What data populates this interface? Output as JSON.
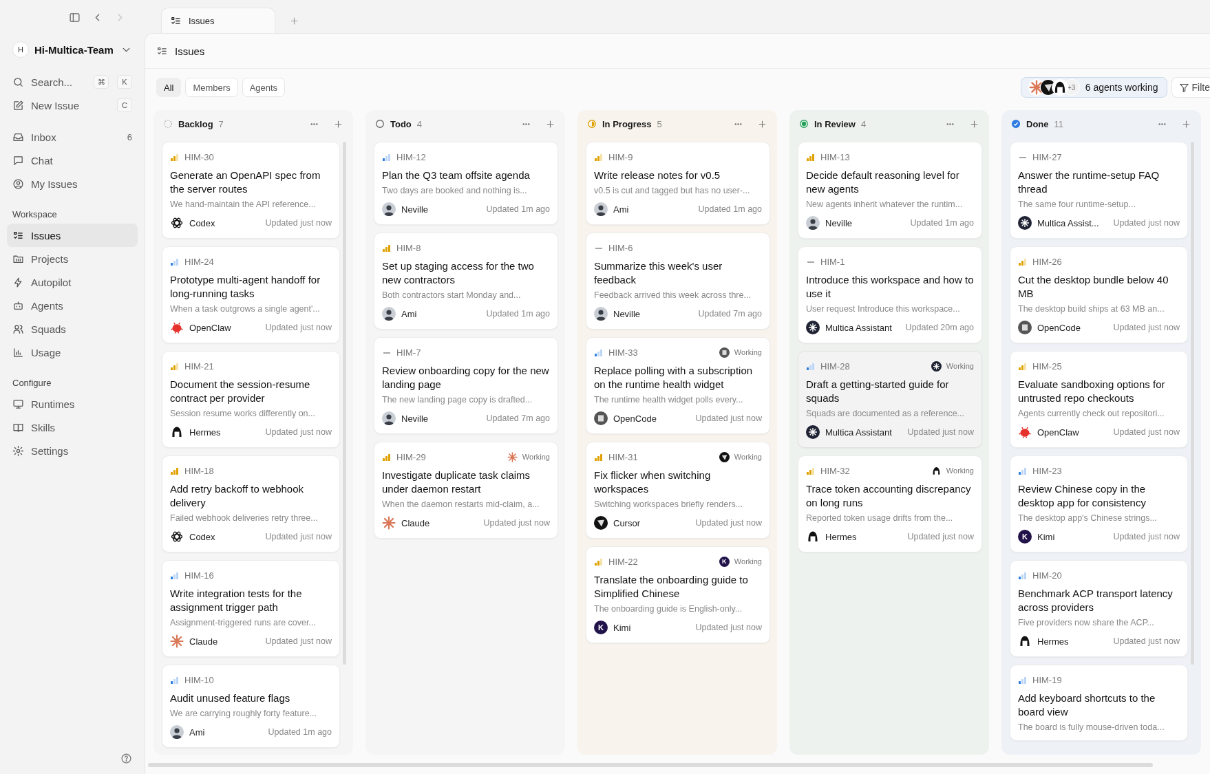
{
  "top_nav": {
    "forward_disabled": true
  },
  "sidebar": {
    "team": {
      "initial": "H",
      "name": "Hi-Multica-Team"
    },
    "actions": [
      {
        "label": "Search...",
        "keys": [
          "⌘",
          "K"
        ]
      },
      {
        "label": "New Issue",
        "keys": [
          "C"
        ]
      }
    ],
    "nav": [
      {
        "label": "Inbox",
        "badge": "6",
        "selected": false
      },
      {
        "label": "Chat",
        "selected": false
      },
      {
        "label": "My Issues",
        "selected": false
      }
    ],
    "sections": [
      {
        "title": "Workspace",
        "items": [
          {
            "label": "Issues",
            "selected": true
          },
          {
            "label": "Projects",
            "selected": false
          },
          {
            "label": "Autopilot",
            "selected": false
          },
          {
            "label": "Agents",
            "selected": false
          },
          {
            "label": "Squads",
            "selected": false
          },
          {
            "label": "Usage",
            "selected": false
          }
        ]
      },
      {
        "title": "Configure",
        "items": [
          {
            "label": "Runtimes",
            "selected": false
          },
          {
            "label": "Skills",
            "selected": false
          },
          {
            "label": "Settings",
            "selected": false
          }
        ]
      }
    ]
  },
  "tabs": [
    {
      "label": "Issues",
      "selected": true
    }
  ],
  "header": {
    "title": "Issues"
  },
  "filters": [
    {
      "label": "All",
      "selected": true
    },
    {
      "label": "Members",
      "selected": false
    },
    {
      "label": "Agents",
      "selected": false
    }
  ],
  "agents_working": {
    "avatars": [
      {
        "kind": "claude"
      },
      {
        "kind": "cursor"
      },
      {
        "kind": "hermes"
      }
    ],
    "more": "+3",
    "label": "6 agents working"
  },
  "filter_button": {
    "label": "Filte"
  },
  "columns": [
    {
      "title": "Backlog",
      "count": "7",
      "kind": "backlog",
      "scroll": true,
      "cards": [
        {
          "id": "HIM-30",
          "priority": {
            "kind": "medium"
          },
          "title": "Generate an OpenAPI spec from the server routes",
          "desc": "We hand-maintain the API reference...",
          "assignee": {
            "name": "Codex",
            "kind": "codex"
          },
          "updated": "Updated just now",
          "selected": false
        },
        {
          "id": "HIM-24",
          "priority": {
            "kind": "low"
          },
          "title": "Prototype multi-agent handoff for long-running tasks",
          "desc": "When a task outgrows a single agent'...",
          "assignee": {
            "name": "OpenClaw",
            "kind": "openclaw"
          },
          "updated": "Updated just now",
          "selected": false
        },
        {
          "id": "HIM-21",
          "priority": {
            "kind": "medium"
          },
          "title": "Document the session-resume contract per provider",
          "desc": "Session resume works differently on...",
          "assignee": {
            "name": "Hermes",
            "kind": "hermes"
          },
          "updated": "Updated just now",
          "selected": false
        },
        {
          "id": "HIM-18",
          "priority": {
            "kind": "high"
          },
          "title": "Add retry backoff to webhook delivery",
          "desc": "Failed webhook deliveries retry three...",
          "assignee": {
            "name": "Codex",
            "kind": "codex"
          },
          "updated": "Updated just now",
          "selected": false
        },
        {
          "id": "HIM-16",
          "priority": {
            "kind": "low"
          },
          "title": "Write integration tests for the assignment trigger path",
          "desc": "Assignment-triggered runs are cover...",
          "assignee": {
            "name": "Claude",
            "kind": "claude"
          },
          "updated": "Updated just now",
          "selected": false
        },
        {
          "id": "HIM-10",
          "priority": {
            "kind": "low"
          },
          "title": "Audit unused feature flags",
          "desc": "We are carrying roughly forty feature...",
          "assignee": {
            "name": "Ami",
            "kind": "person"
          },
          "updated": "Updated 1m ago",
          "selected": false
        }
      ]
    },
    {
      "title": "Todo",
      "count": "4",
      "kind": "todo",
      "scroll": false,
      "cards": [
        {
          "id": "HIM-12",
          "priority": {
            "kind": "low"
          },
          "title": "Plan the Q3 team offsite agenda",
          "desc": "Two days are booked and nothing is...",
          "assignee": {
            "name": "Neville",
            "kind": "person"
          },
          "updated": "Updated 1m ago",
          "selected": false
        },
        {
          "id": "HIM-8",
          "priority": {
            "kind": "high"
          },
          "title": "Set up staging access for the two new contractors",
          "desc": "Both contractors start Monday and...",
          "assignee": {
            "name": "Ami",
            "kind": "person"
          },
          "updated": "Updated 1m ago",
          "selected": false
        },
        {
          "id": "HIM-7",
          "priority": {
            "kind": "none"
          },
          "title": "Review onboarding copy for the new landing page",
          "desc": "The new landing page copy is drafted...",
          "assignee": {
            "name": "Neville",
            "kind": "person"
          },
          "updated": "Updated 7m ago",
          "selected": false
        },
        {
          "id": "HIM-29",
          "priority": {
            "kind": "high"
          },
          "title": "Investigate duplicate task claims under daemon restart",
          "desc": "When the daemon restarts mid-claim, a...",
          "assignee": {
            "name": "Claude",
            "kind": "claude"
          },
          "updated": "Updated just now",
          "working": {
            "kind": "claude",
            "label": "Working"
          },
          "selected": false
        }
      ]
    },
    {
      "title": "In Progress",
      "count": "5",
      "kind": "in_progress",
      "scroll": false,
      "cards": [
        {
          "id": "HIM-9",
          "priority": {
            "kind": "medium"
          },
          "title": "Write release notes for v0.5",
          "desc": "v0.5 is cut and tagged but has no user-...",
          "assignee": {
            "name": "Ami",
            "kind": "person"
          },
          "updated": "Updated 1m ago",
          "selected": false
        },
        {
          "id": "HIM-6",
          "priority": {
            "kind": "none"
          },
          "title": "Summarize this week's user feedback",
          "desc": "Feedback arrived this week across thre...",
          "assignee": {
            "name": "Neville",
            "kind": "person"
          },
          "updated": "Updated 7m ago",
          "selected": false
        },
        {
          "id": "HIM-33",
          "priority": {
            "kind": "low"
          },
          "title": "Replace polling with a subscription on the runtime health widget",
          "desc": "The runtime health widget polls every...",
          "assignee": {
            "name": "OpenCode",
            "kind": "opencode"
          },
          "updated": "Updated just now",
          "working": {
            "kind": "opencode",
            "label": "Working"
          },
          "selected": false
        },
        {
          "id": "HIM-31",
          "priority": {
            "kind": "high"
          },
          "title": "Fix flicker when switching workspaces",
          "desc": "Switching workspaces briefly renders...",
          "assignee": {
            "name": "Cursor",
            "kind": "cursor"
          },
          "updated": "Updated just now",
          "working": {
            "kind": "cursor",
            "label": "Working"
          },
          "selected": false
        },
        {
          "id": "HIM-22",
          "priority": {
            "kind": "medium"
          },
          "title": "Translate the onboarding guide to Simplified Chinese",
          "desc": "The onboarding guide is English-only...",
          "assignee": {
            "name": "Kimi",
            "kind": "kimi",
            "letter": "K"
          },
          "updated": "Updated just now",
          "working": {
            "kind": "kimi",
            "letter": "K",
            "label": "Working"
          },
          "selected": false
        }
      ]
    },
    {
      "title": "In Review",
      "count": "4",
      "kind": "in_review",
      "scroll": false,
      "cards": [
        {
          "id": "HIM-13",
          "priority": {
            "kind": "high"
          },
          "title": "Decide default reasoning level for new agents",
          "desc": "New agents inherit whatever the runtim...",
          "assignee": {
            "name": "Neville",
            "kind": "person"
          },
          "updated": "Updated 1m ago",
          "selected": false
        },
        {
          "id": "HIM-1",
          "priority": {
            "kind": "none"
          },
          "title": "Introduce this workspace and how to use it",
          "desc": "User request Introduce this workspace...",
          "assignee": {
            "name": "Multica Assistant",
            "kind": "multica"
          },
          "updated": "Updated 20m ago",
          "selected": false
        },
        {
          "id": "HIM-28",
          "priority": {
            "kind": "low"
          },
          "title": "Draft a getting-started guide for squads",
          "desc": "Squads are documented as a reference...",
          "assignee": {
            "name": "Multica Assistant",
            "kind": "multica"
          },
          "updated": "Updated just now",
          "working": {
            "kind": "multica",
            "label": "Working"
          },
          "selected": true
        },
        {
          "id": "HIM-32",
          "priority": {
            "kind": "medium"
          },
          "title": "Trace token accounting discrepancy on long runs",
          "desc": "Reported token usage drifts from the...",
          "assignee": {
            "name": "Hermes",
            "kind": "hermes"
          },
          "updated": "Updated just now",
          "working": {
            "kind": "hermes",
            "label": "Working"
          },
          "selected": false
        }
      ]
    },
    {
      "title": "Done",
      "count": "11",
      "kind": "done",
      "scroll": true,
      "cards": [
        {
          "id": "HIM-27",
          "priority": {
            "kind": "none"
          },
          "title": "Answer the runtime-setup FAQ thread",
          "desc": "The same four runtime-setup...",
          "assignee": {
            "name": "Multica Assist...",
            "kind": "multica"
          },
          "updated": "Updated just now",
          "selected": false
        },
        {
          "id": "HIM-26",
          "priority": {
            "kind": "medium"
          },
          "title": "Cut the desktop bundle below 40 MB",
          "desc": "The desktop build ships at 63 MB an...",
          "assignee": {
            "name": "OpenCode",
            "kind": "opencode"
          },
          "updated": "Updated just now",
          "selected": false
        },
        {
          "id": "HIM-25",
          "priority": {
            "kind": "medium"
          },
          "title": "Evaluate sandboxing options for untrusted repo checkouts",
          "desc": "Agents currently check out repositori...",
          "assignee": {
            "name": "OpenClaw",
            "kind": "openclaw"
          },
          "updated": "Updated just now",
          "selected": false
        },
        {
          "id": "HIM-23",
          "priority": {
            "kind": "low"
          },
          "title": "Review Chinese copy in the desktop app for consistency",
          "desc": "The desktop app's Chinese strings...",
          "assignee": {
            "name": "Kimi",
            "kind": "kimi",
            "letter": "K"
          },
          "updated": "Updated just now",
          "selected": false
        },
        {
          "id": "HIM-20",
          "priority": {
            "kind": "low"
          },
          "title": "Benchmark ACP transport latency across providers",
          "desc": "Five providers now share the ACP...",
          "assignee": {
            "name": "Hermes",
            "kind": "hermes"
          },
          "updated": "Updated just now",
          "selected": false
        },
        {
          "id": "HIM-19",
          "priority": {
            "kind": "low"
          },
          "title": "Add keyboard shortcuts to the board view",
          "desc": "The board is fully mouse-driven toda...",
          "selected": false
        }
      ]
    }
  ]
}
